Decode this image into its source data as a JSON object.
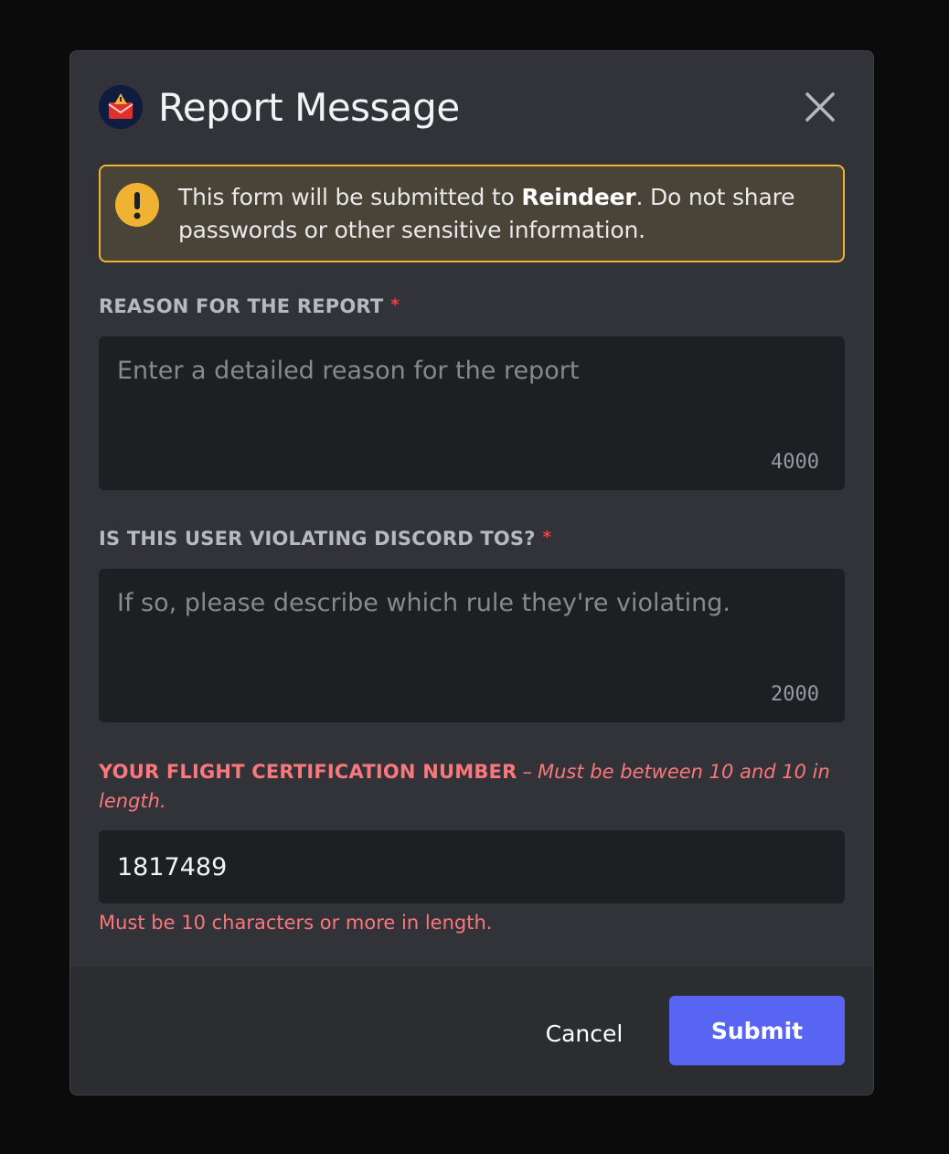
{
  "dialog": {
    "title": "Report Message",
    "app_icon": "reindeer-app-icon"
  },
  "warning": {
    "icon": "exclamation-icon",
    "text_before": "This form will be submitted to ",
    "app_name": "Reindeer",
    "text_after": ". Do not share passwords or other sensitive information."
  },
  "fields": {
    "reason": {
      "label": "REASON FOR THE REPORT",
      "required_mark": "*",
      "placeholder": "Enter a detailed reason for the report",
      "value": "",
      "counter": "4000"
    },
    "tos": {
      "label": "IS THIS USER VIOLATING DISCORD TOS?",
      "required_mark": "*",
      "placeholder": "If so, please describe which rule they're violating.",
      "value": "",
      "counter": "2000"
    },
    "certification": {
      "label": "YOUR FLIGHT CERTIFICATION NUMBER",
      "separator": "–",
      "hint": "Must be between 10 and 10 in length.",
      "value": "1817489",
      "error": "Must be 10 characters or more in length."
    }
  },
  "footer": {
    "cancel_label": "Cancel",
    "submit_label": "Submit"
  },
  "colors": {
    "accent": "#5865f2",
    "warning": "#f0b232",
    "error": "#fa777c",
    "required": "#f23f43"
  }
}
